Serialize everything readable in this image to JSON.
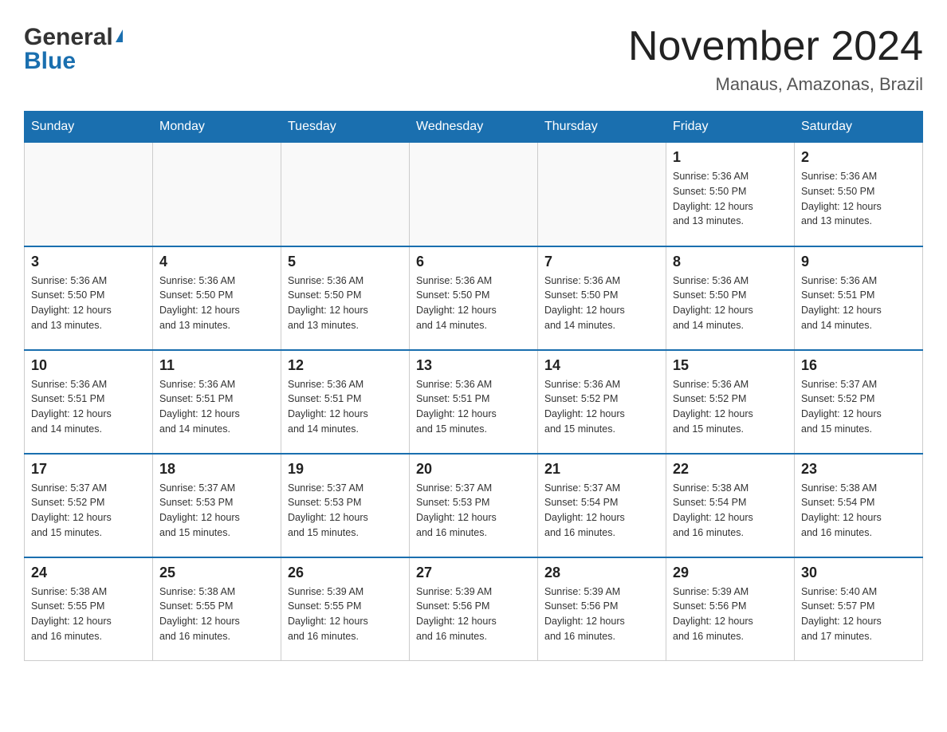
{
  "header": {
    "logo_general": "General",
    "logo_blue": "Blue",
    "title": "November 2024",
    "subtitle": "Manaus, Amazonas, Brazil"
  },
  "weekdays": [
    "Sunday",
    "Monday",
    "Tuesday",
    "Wednesday",
    "Thursday",
    "Friday",
    "Saturday"
  ],
  "weeks": [
    [
      {
        "day": "",
        "info": ""
      },
      {
        "day": "",
        "info": ""
      },
      {
        "day": "",
        "info": ""
      },
      {
        "day": "",
        "info": ""
      },
      {
        "day": "",
        "info": ""
      },
      {
        "day": "1",
        "info": "Sunrise: 5:36 AM\nSunset: 5:50 PM\nDaylight: 12 hours\nand 13 minutes."
      },
      {
        "day": "2",
        "info": "Sunrise: 5:36 AM\nSunset: 5:50 PM\nDaylight: 12 hours\nand 13 minutes."
      }
    ],
    [
      {
        "day": "3",
        "info": "Sunrise: 5:36 AM\nSunset: 5:50 PM\nDaylight: 12 hours\nand 13 minutes."
      },
      {
        "day": "4",
        "info": "Sunrise: 5:36 AM\nSunset: 5:50 PM\nDaylight: 12 hours\nand 13 minutes."
      },
      {
        "day": "5",
        "info": "Sunrise: 5:36 AM\nSunset: 5:50 PM\nDaylight: 12 hours\nand 13 minutes."
      },
      {
        "day": "6",
        "info": "Sunrise: 5:36 AM\nSunset: 5:50 PM\nDaylight: 12 hours\nand 14 minutes."
      },
      {
        "day": "7",
        "info": "Sunrise: 5:36 AM\nSunset: 5:50 PM\nDaylight: 12 hours\nand 14 minutes."
      },
      {
        "day": "8",
        "info": "Sunrise: 5:36 AM\nSunset: 5:50 PM\nDaylight: 12 hours\nand 14 minutes."
      },
      {
        "day": "9",
        "info": "Sunrise: 5:36 AM\nSunset: 5:51 PM\nDaylight: 12 hours\nand 14 minutes."
      }
    ],
    [
      {
        "day": "10",
        "info": "Sunrise: 5:36 AM\nSunset: 5:51 PM\nDaylight: 12 hours\nand 14 minutes."
      },
      {
        "day": "11",
        "info": "Sunrise: 5:36 AM\nSunset: 5:51 PM\nDaylight: 12 hours\nand 14 minutes."
      },
      {
        "day": "12",
        "info": "Sunrise: 5:36 AM\nSunset: 5:51 PM\nDaylight: 12 hours\nand 14 minutes."
      },
      {
        "day": "13",
        "info": "Sunrise: 5:36 AM\nSunset: 5:51 PM\nDaylight: 12 hours\nand 15 minutes."
      },
      {
        "day": "14",
        "info": "Sunrise: 5:36 AM\nSunset: 5:52 PM\nDaylight: 12 hours\nand 15 minutes."
      },
      {
        "day": "15",
        "info": "Sunrise: 5:36 AM\nSunset: 5:52 PM\nDaylight: 12 hours\nand 15 minutes."
      },
      {
        "day": "16",
        "info": "Sunrise: 5:37 AM\nSunset: 5:52 PM\nDaylight: 12 hours\nand 15 minutes."
      }
    ],
    [
      {
        "day": "17",
        "info": "Sunrise: 5:37 AM\nSunset: 5:52 PM\nDaylight: 12 hours\nand 15 minutes."
      },
      {
        "day": "18",
        "info": "Sunrise: 5:37 AM\nSunset: 5:53 PM\nDaylight: 12 hours\nand 15 minutes."
      },
      {
        "day": "19",
        "info": "Sunrise: 5:37 AM\nSunset: 5:53 PM\nDaylight: 12 hours\nand 15 minutes."
      },
      {
        "day": "20",
        "info": "Sunrise: 5:37 AM\nSunset: 5:53 PM\nDaylight: 12 hours\nand 16 minutes."
      },
      {
        "day": "21",
        "info": "Sunrise: 5:37 AM\nSunset: 5:54 PM\nDaylight: 12 hours\nand 16 minutes."
      },
      {
        "day": "22",
        "info": "Sunrise: 5:38 AM\nSunset: 5:54 PM\nDaylight: 12 hours\nand 16 minutes."
      },
      {
        "day": "23",
        "info": "Sunrise: 5:38 AM\nSunset: 5:54 PM\nDaylight: 12 hours\nand 16 minutes."
      }
    ],
    [
      {
        "day": "24",
        "info": "Sunrise: 5:38 AM\nSunset: 5:55 PM\nDaylight: 12 hours\nand 16 minutes."
      },
      {
        "day": "25",
        "info": "Sunrise: 5:38 AM\nSunset: 5:55 PM\nDaylight: 12 hours\nand 16 minutes."
      },
      {
        "day": "26",
        "info": "Sunrise: 5:39 AM\nSunset: 5:55 PM\nDaylight: 12 hours\nand 16 minutes."
      },
      {
        "day": "27",
        "info": "Sunrise: 5:39 AM\nSunset: 5:56 PM\nDaylight: 12 hours\nand 16 minutes."
      },
      {
        "day": "28",
        "info": "Sunrise: 5:39 AM\nSunset: 5:56 PM\nDaylight: 12 hours\nand 16 minutes."
      },
      {
        "day": "29",
        "info": "Sunrise: 5:39 AM\nSunset: 5:56 PM\nDaylight: 12 hours\nand 16 minutes."
      },
      {
        "day": "30",
        "info": "Sunrise: 5:40 AM\nSunset: 5:57 PM\nDaylight: 12 hours\nand 17 minutes."
      }
    ]
  ]
}
